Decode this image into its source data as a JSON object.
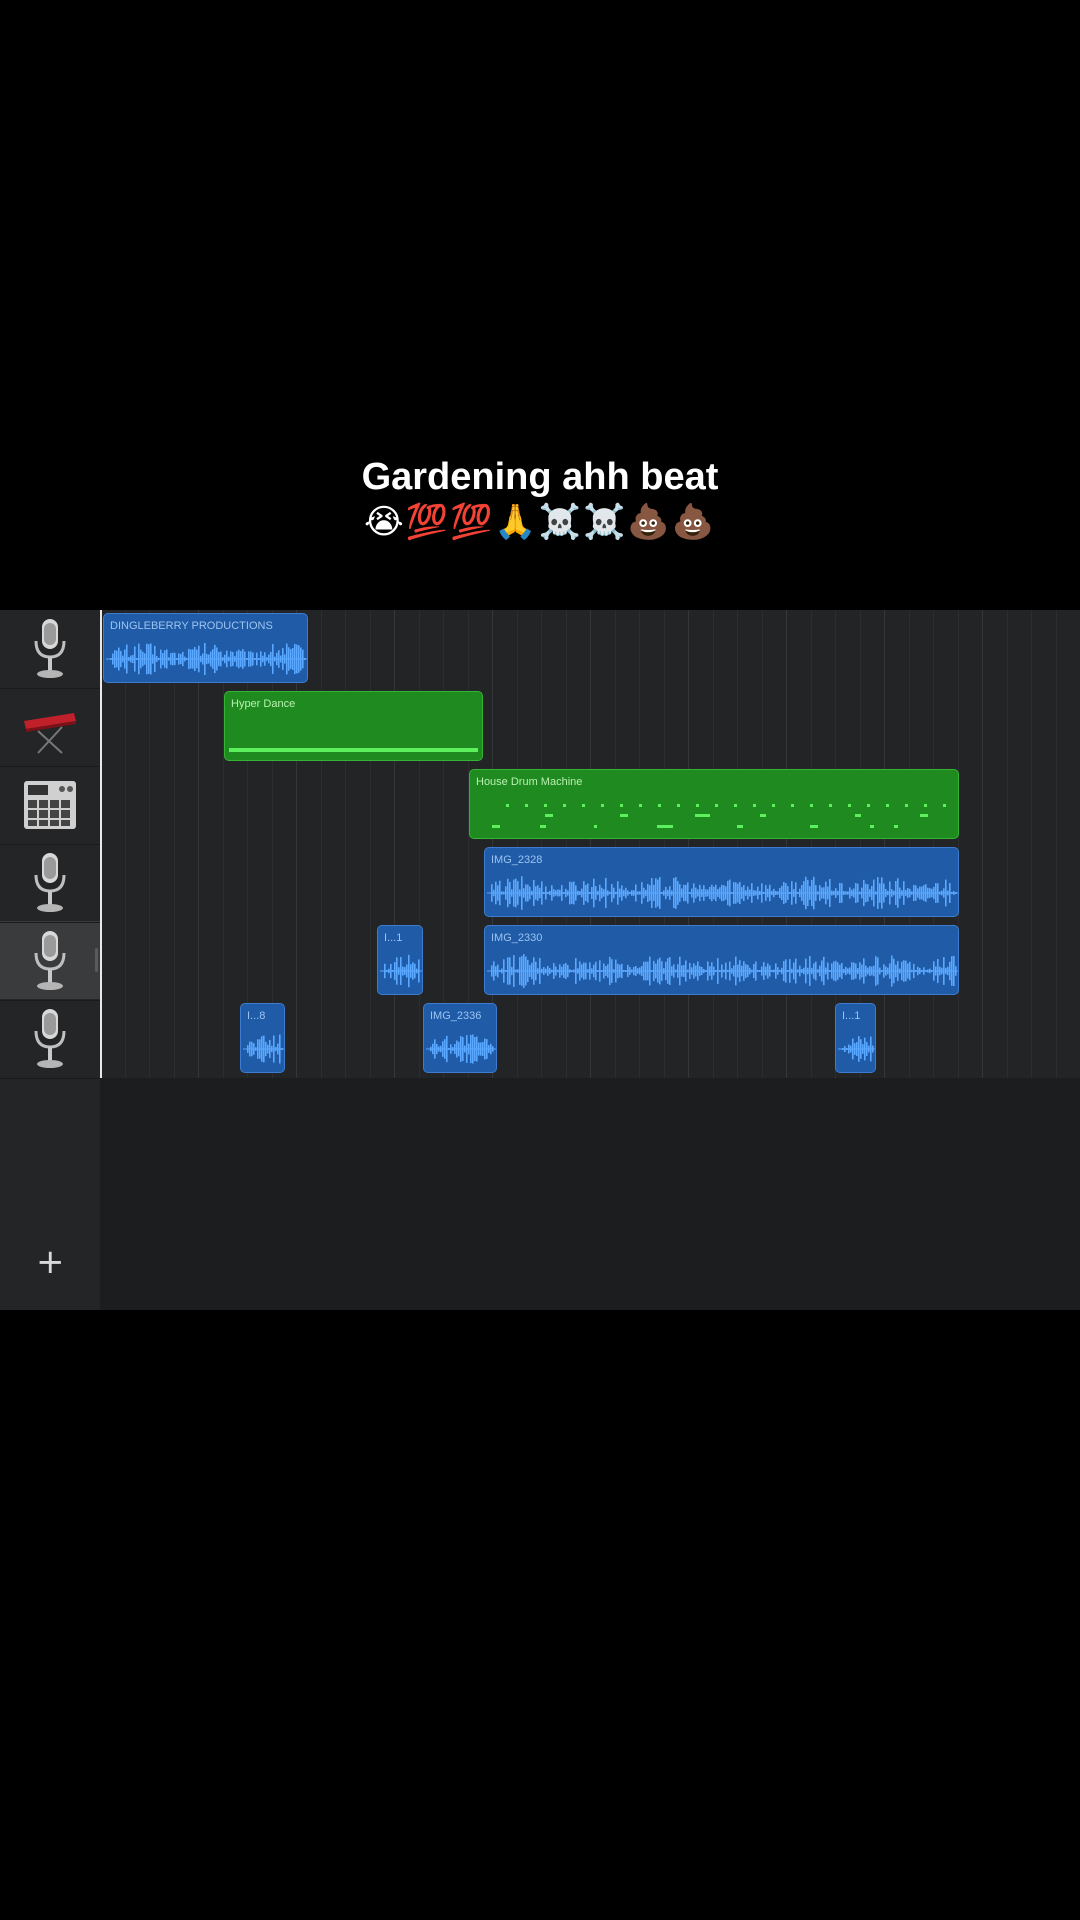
{
  "caption": {
    "title": "Gardening ahh beat",
    "emoji": "😭💯💯🙏☠️☠️💩💩"
  },
  "project": {
    "add_track_label": "+",
    "tracks": [
      {
        "instrument": "microphone-icon",
        "selected": false
      },
      {
        "instrument": "keyboard-synth-icon",
        "selected": false
      },
      {
        "instrument": "drum-machine-icon",
        "selected": false
      },
      {
        "instrument": "microphone-icon",
        "selected": false
      },
      {
        "instrument": "microphone-icon",
        "selected": true
      },
      {
        "instrument": "microphone-icon",
        "selected": false
      }
    ],
    "regions": [
      {
        "track": 0,
        "type": "audio",
        "label": "DINGLEBERRY PRODUCTIONS"
      },
      {
        "track": 1,
        "type": "midi",
        "label": "Hyper Dance"
      },
      {
        "track": 2,
        "type": "midi",
        "label": "House Drum Machine"
      },
      {
        "track": 3,
        "type": "audio",
        "label": "IMG_2328"
      },
      {
        "track": 4,
        "type": "audio",
        "label": "I...1"
      },
      {
        "track": 4,
        "type": "audio",
        "label": "IMG_2330"
      },
      {
        "track": 5,
        "type": "audio",
        "label": "I...8"
      },
      {
        "track": 5,
        "type": "audio",
        "label": "IMG_2336"
      },
      {
        "track": 5,
        "type": "audio",
        "label": "I...1"
      }
    ]
  },
  "colors": {
    "audio_region": "#1f5ba6",
    "midi_region": "#1f8a1f",
    "waveform": "#5aa8ff",
    "midi_notes": "#5cf05c"
  }
}
